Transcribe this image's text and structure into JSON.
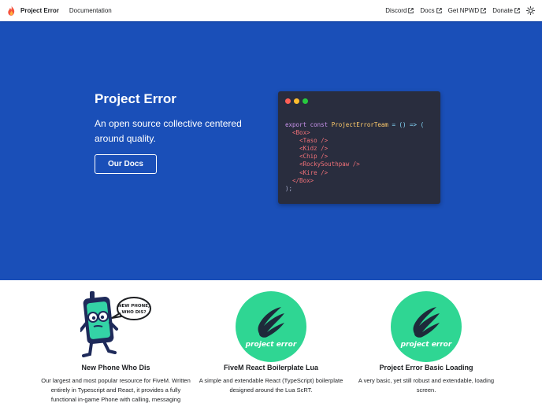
{
  "navbar": {
    "brand": "Project Error",
    "links_left": [
      "Documentation"
    ],
    "links_right": [
      "Discord",
      "Docs",
      "Get NPWD",
      "Donate"
    ],
    "icons": {
      "brand": "flame-logo-icon",
      "external": "external-link-icon",
      "theme": "sun-icon"
    }
  },
  "hero": {
    "title": "Project Error",
    "subtitle": "An open source collective centered around quality.",
    "button_label": "Our Docs",
    "background_color": "#1a4fb8"
  },
  "code_window": {
    "line1_kw": "export const ",
    "line1_fn": "ProjectErrorTeam",
    "line1_op": " = () => (",
    "box_open": "<Box>",
    "members": [
      "<Taso />",
      "<Kidz />",
      "<Chip />",
      "<RockySouthpaw />",
      "<Kire />"
    ],
    "box_close": "</Box>",
    "end": ");"
  },
  "features": [
    {
      "title": "New Phone Who Dis",
      "description": "Our largest and most popular resource for FiveM. Written entirely in Typescript and React, it provides a fully functional in-game Phone with calling, messaging",
      "image_text": [
        "NEW PHONE,",
        "WHO DIS?"
      ]
    },
    {
      "title": "FiveM React Boilerplate Lua",
      "description": "A simple and extendable React (TypeScript) boilerplate designed around the Lua ScRT.",
      "image_text": "project error"
    },
    {
      "title": "Project Error Basic Loading",
      "description": "A very basic, yet still robust and extendable, loading screen.",
      "image_text": "project error"
    }
  ],
  "colors": {
    "accent": "#1a4fb8",
    "logo_green": "#2fd693",
    "code_bg": "#292d3e"
  }
}
